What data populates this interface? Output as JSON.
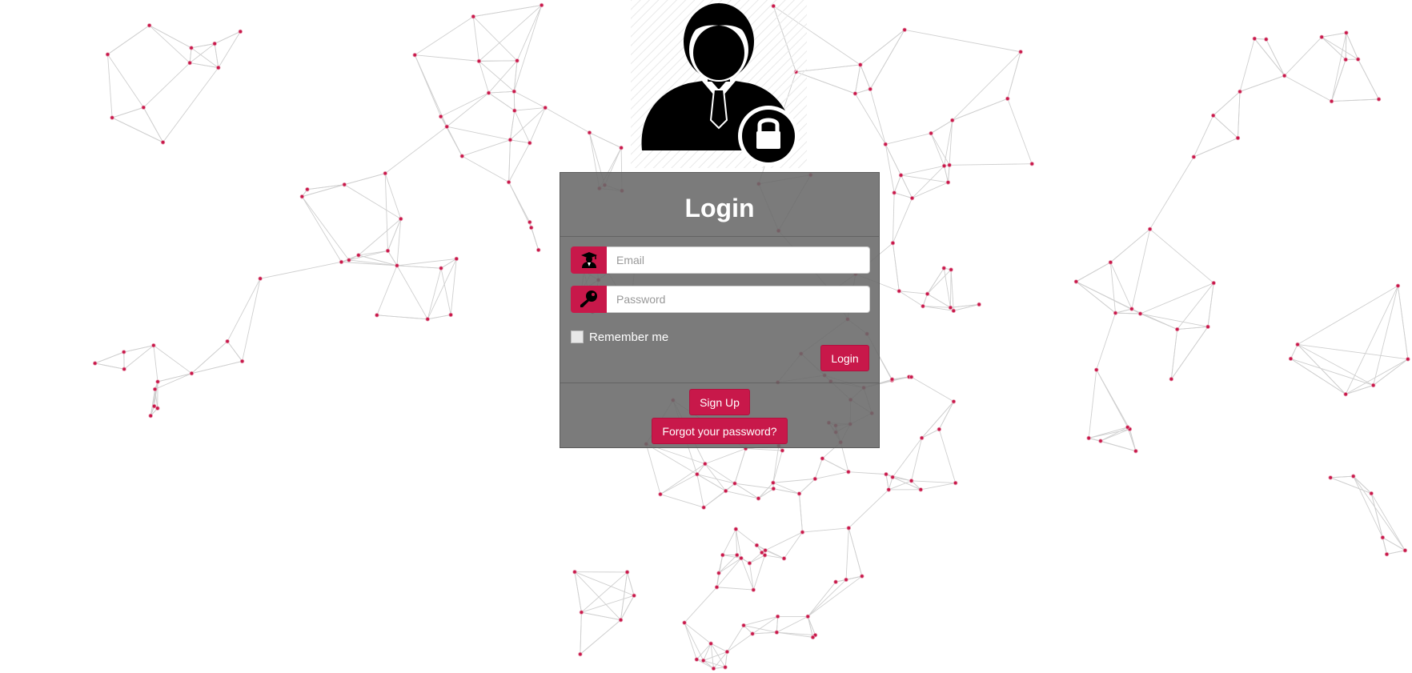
{
  "login": {
    "title": "Login",
    "email_placeholder": "Email",
    "password_placeholder": "Password",
    "remember_label": "Remember me",
    "login_button": "Login",
    "signup_button": "Sign Up",
    "forgot_button": "Forgot your password?"
  },
  "icons": {
    "avatar": "user-lock-icon",
    "email_addon": "graduate-user-icon",
    "password_addon": "key-icon"
  },
  "colors": {
    "accent": "#c8184a",
    "panel": "#6b6b6b",
    "network_line": "#cfcfcf"
  }
}
